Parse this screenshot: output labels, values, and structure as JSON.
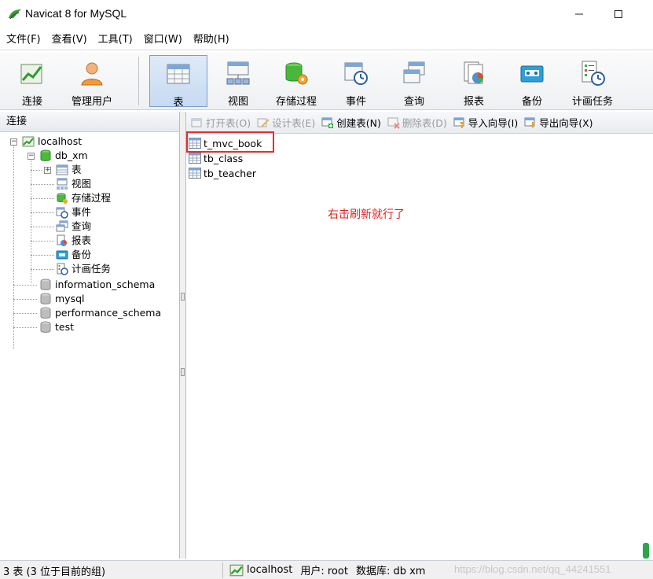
{
  "window": {
    "title": "Navicat 8 for MySQL",
    "min_symbol": "—",
    "max_symbol": "☐"
  },
  "menu": [
    "文件(F)",
    "查看(V)",
    "工具(T)",
    "窗口(W)",
    "帮助(H)"
  ],
  "toolbar": {
    "connect": "连接",
    "manage_users": "管理用户",
    "table": "表",
    "view": "视图",
    "procedure": "存储过程",
    "event": "事件",
    "query": "查询",
    "report": "报表",
    "backup": "备份",
    "schedule": "计画任务"
  },
  "left_panel": {
    "header": "连接",
    "server": "localhost",
    "database": "db_xm",
    "db_children": [
      "表",
      "视图",
      "存储过程",
      "事件",
      "查询",
      "报表",
      "备份",
      "计画任务"
    ],
    "other_databases": [
      "information_schema",
      "mysql",
      "performance_schema",
      "test"
    ]
  },
  "object_toolbar": {
    "open": "打开表(O)",
    "design": "设计表(E)",
    "create": "创建表(N)",
    "delete": "删除表(D)",
    "import": "导入向导(I)",
    "export": "导出向导(X)"
  },
  "tables": [
    "t_mvc_book",
    "tb_class",
    "tb_teacher"
  ],
  "annotation": "右击刷新就行了",
  "statusbar": {
    "count": "3 表 (3 位于目前的组)",
    "connection": "localhost",
    "user": "用户: root",
    "database": "数据库: db xm",
    "watermark": "https://blog.csdn.net/qq_44241551"
  },
  "colors": {
    "highlight": "#e03030",
    "annotation": "#e02020",
    "accent": "#2f6fb5"
  }
}
